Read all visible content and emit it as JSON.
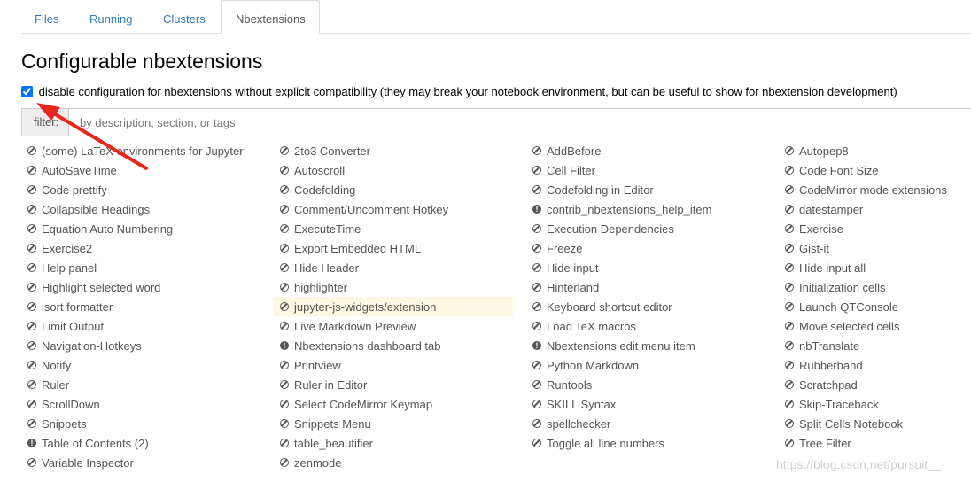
{
  "tabs": [
    {
      "label": "Files",
      "active": false
    },
    {
      "label": "Running",
      "active": false
    },
    {
      "label": "Clusters",
      "active": false
    },
    {
      "label": "Nbextensions",
      "active": true
    }
  ],
  "page_title": "Configurable nbextensions",
  "compat_checkbox": {
    "checked": true,
    "label": "disable configuration for nbextensions without explicit compatibility (they may break your notebook environment, but can be useful to show for nbextension development)"
  },
  "filter": {
    "label": "filter:",
    "placeholder": "by description, section, or tags",
    "value": ""
  },
  "extensions": [
    {
      "label": "(some) LaTeX environments for Jupyter",
      "icon": "disabled"
    },
    {
      "label": "2to3 Converter",
      "icon": "disabled"
    },
    {
      "label": "AddBefore",
      "icon": "disabled"
    },
    {
      "label": "Autopep8",
      "icon": "disabled"
    },
    {
      "label": "AutoSaveTime",
      "icon": "disabled"
    },
    {
      "label": "Autoscroll",
      "icon": "disabled"
    },
    {
      "label": "Cell Filter",
      "icon": "disabled"
    },
    {
      "label": "Code Font Size",
      "icon": "disabled"
    },
    {
      "label": "Code prettify",
      "icon": "disabled"
    },
    {
      "label": "Codefolding",
      "icon": "disabled"
    },
    {
      "label": "Codefolding in Editor",
      "icon": "disabled"
    },
    {
      "label": "CodeMirror mode extensions",
      "icon": "disabled"
    },
    {
      "label": "Collapsible Headings",
      "icon": "disabled"
    },
    {
      "label": "Comment/Uncomment Hotkey",
      "icon": "disabled"
    },
    {
      "label": "contrib_nbextensions_help_item",
      "icon": "warning"
    },
    {
      "label": "datestamper",
      "icon": "disabled"
    },
    {
      "label": "Equation Auto Numbering",
      "icon": "disabled"
    },
    {
      "label": "ExecuteTime",
      "icon": "disabled"
    },
    {
      "label": "Execution Dependencies",
      "icon": "disabled"
    },
    {
      "label": "Exercise",
      "icon": "disabled"
    },
    {
      "label": "Exercise2",
      "icon": "disabled"
    },
    {
      "label": "Export Embedded HTML",
      "icon": "disabled"
    },
    {
      "label": "Freeze",
      "icon": "disabled"
    },
    {
      "label": "Gist-it",
      "icon": "disabled"
    },
    {
      "label": "Help panel",
      "icon": "disabled"
    },
    {
      "label": "Hide Header",
      "icon": "disabled"
    },
    {
      "label": "Hide input",
      "icon": "disabled"
    },
    {
      "label": "Hide input all",
      "icon": "disabled"
    },
    {
      "label": "Highlight selected word",
      "icon": "disabled"
    },
    {
      "label": "highlighter",
      "icon": "disabled"
    },
    {
      "label": "Hinterland",
      "icon": "disabled"
    },
    {
      "label": "Initialization cells",
      "icon": "disabled"
    },
    {
      "label": "isort formatter",
      "icon": "disabled"
    },
    {
      "label": "jupyter-js-widgets/extension",
      "icon": "disabled",
      "selected": true
    },
    {
      "label": "Keyboard shortcut editor",
      "icon": "disabled"
    },
    {
      "label": "Launch QTConsole",
      "icon": "disabled"
    },
    {
      "label": "Limit Output",
      "icon": "disabled"
    },
    {
      "label": "Live Markdown Preview",
      "icon": "disabled"
    },
    {
      "label": "Load TeX macros",
      "icon": "disabled"
    },
    {
      "label": "Move selected cells",
      "icon": "disabled"
    },
    {
      "label": "Navigation-Hotkeys",
      "icon": "disabled"
    },
    {
      "label": "Nbextensions dashboard tab",
      "icon": "warning"
    },
    {
      "label": "Nbextensions edit menu item",
      "icon": "warning"
    },
    {
      "label": "nbTranslate",
      "icon": "disabled"
    },
    {
      "label": "Notify",
      "icon": "disabled"
    },
    {
      "label": "Printview",
      "icon": "disabled"
    },
    {
      "label": "Python Markdown",
      "icon": "disabled"
    },
    {
      "label": "Rubberband",
      "icon": "disabled"
    },
    {
      "label": "Ruler",
      "icon": "disabled"
    },
    {
      "label": "Ruler in Editor",
      "icon": "disabled"
    },
    {
      "label": "Runtools",
      "icon": "disabled"
    },
    {
      "label": "Scratchpad",
      "icon": "disabled"
    },
    {
      "label": "ScrollDown",
      "icon": "disabled"
    },
    {
      "label": "Select CodeMirror Keymap",
      "icon": "disabled"
    },
    {
      "label": "SKILL Syntax",
      "icon": "disabled"
    },
    {
      "label": "Skip-Traceback",
      "icon": "disabled"
    },
    {
      "label": "Snippets",
      "icon": "disabled"
    },
    {
      "label": "Snippets Menu",
      "icon": "disabled"
    },
    {
      "label": "spellchecker",
      "icon": "disabled"
    },
    {
      "label": "Split Cells Notebook",
      "icon": "disabled"
    },
    {
      "label": "Table of Contents (2)",
      "icon": "warning"
    },
    {
      "label": "table_beautifier",
      "icon": "disabled"
    },
    {
      "label": "Toggle all line numbers",
      "icon": "disabled"
    },
    {
      "label": "Tree Filter",
      "icon": "disabled"
    },
    {
      "label": "Variable Inspector",
      "icon": "disabled"
    },
    {
      "label": "zenmode",
      "icon": "disabled"
    }
  ],
  "watermark": "https://blog.csdn.net/pursuit__",
  "colors": {
    "link": "#337ab7",
    "selected_row": "#fcf8e3",
    "annotation_arrow": "#e8271c"
  }
}
